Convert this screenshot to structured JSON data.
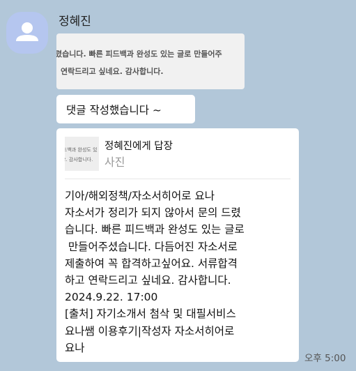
{
  "sender": {
    "name": "정혜진"
  },
  "image_message": {
    "lines": [
      "렸습니다. 빠른 피드백과 완성도 있는 글로 만들어주",
      "연락드리고 싶네요. 감사합니다."
    ]
  },
  "message1": {
    "text": "댓글 작성했습니다 ~"
  },
  "message2": {
    "reply_to": "정혜진에게 답장",
    "reply_type": "사진",
    "thumbnail_lines": [
      "드백과 완성도 있",
      "2. 감사합니다."
    ],
    "body_lines": [
      "기아/해외정책/자소서히어로 요나",
      "자소서가 정리가 되지 않아서 문의 드렸",
      "습니다. 빠른 피드백과 완성도 있는 글로",
      " 만들어주셨습니다. 다듬어진 자소서로",
      "제출하여 꼭 합격하고싶어요. 서류합격",
      "하고 연락드리고 싶네요. 감사합니다.",
      "2024.9.22. 17:00",
      "[출처] 자기소개서 첨삭 및 대필서비스",
      "요나쌤 이용후기|작성자 자소서히어로",
      "요나"
    ]
  },
  "timestamp": "오후 5:00"
}
